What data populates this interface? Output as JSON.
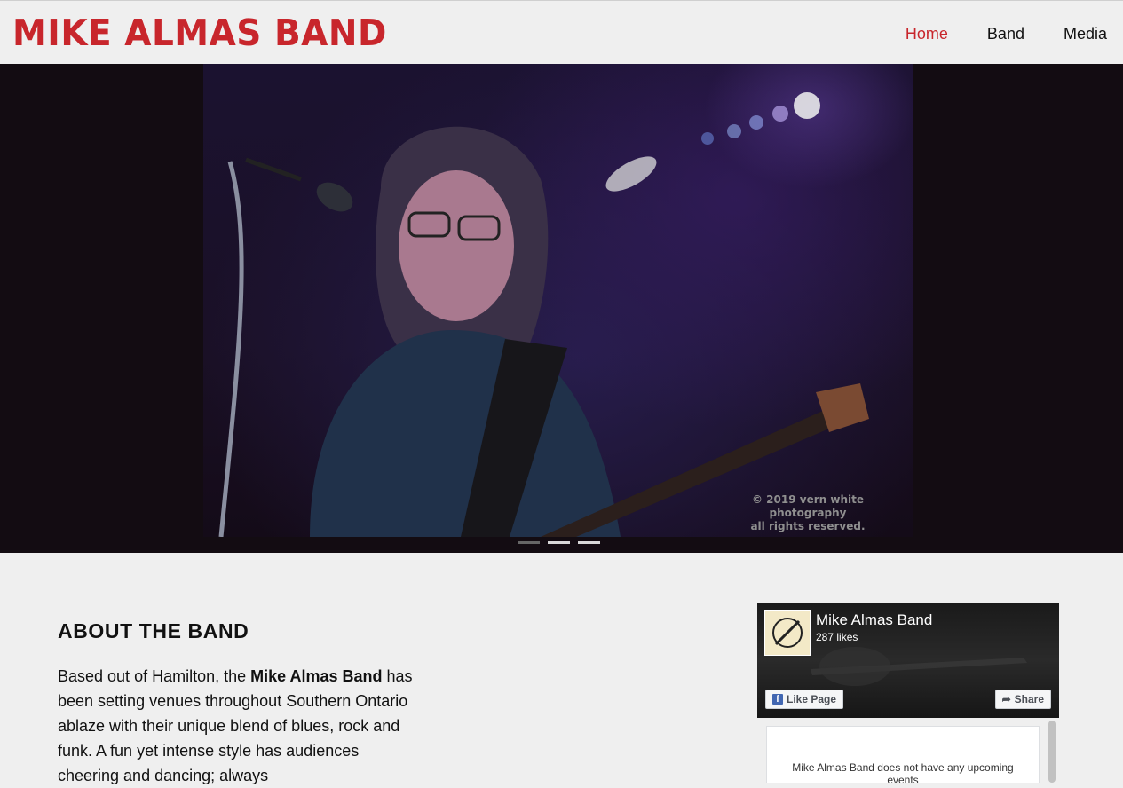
{
  "header": {
    "logo": "MIKE ALMAS BAND",
    "nav": [
      {
        "label": "Home",
        "active": true
      },
      {
        "label": "Band",
        "active": false
      },
      {
        "label": "Media",
        "active": false
      }
    ]
  },
  "hero": {
    "watermark_line1": "© 2019 vern white photography",
    "watermark_line2": "all rights reserved.",
    "slides": 3,
    "active_slide": 2
  },
  "about": {
    "title": "ABOUT THE BAND",
    "text_before": "Based out of Hamilton, the ",
    "text_bold": "Mike Almas Band",
    "text_after": " has been setting venues throughout Southern Ontario ablaze with their unique blend of blues, rock and funk. A fun yet intense style has audiences cheering and dancing; always"
  },
  "facebook": {
    "page_name": "Mike Almas Band",
    "likes": "287 likes",
    "like_button": "Like Page",
    "share_button": "Share",
    "events_text": "Mike Almas Band does not have any upcoming events"
  },
  "colors": {
    "brand_red": "#c8262c",
    "background": "#efefef",
    "hero_bg": "#130c12"
  }
}
